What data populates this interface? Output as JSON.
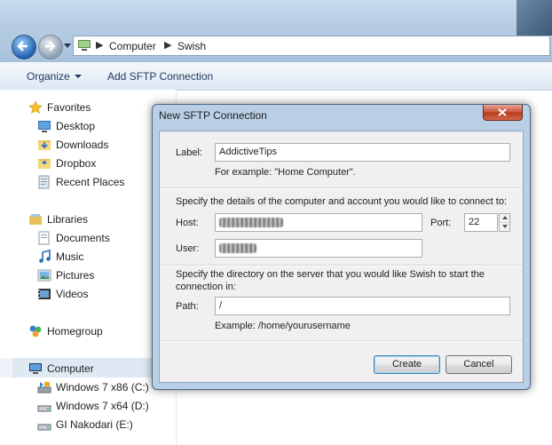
{
  "address": {
    "crumbs": [
      "Computer",
      "Swish"
    ],
    "separator": "▶"
  },
  "toolbar": {
    "organize": "Organize",
    "add_sftp": "Add SFTP Connection"
  },
  "sidebar": {
    "favorites": {
      "label": "Favorites",
      "items": [
        "Desktop",
        "Downloads",
        "Dropbox",
        "Recent Places"
      ]
    },
    "libraries": {
      "label": "Libraries",
      "items": [
        "Documents",
        "Music",
        "Pictures",
        "Videos"
      ]
    },
    "homegroup": {
      "label": "Homegroup"
    },
    "computer": {
      "label": "Computer",
      "items": [
        "Windows 7 x86 (C:)",
        "Windows 7 x64 (D:)",
        "GI Nakodari (E:)"
      ]
    }
  },
  "dialog": {
    "title": "New SFTP Connection",
    "label_caption": "Label:",
    "label_value": "AddictiveTips",
    "label_example": "For example: \"Home Computer\".",
    "details_text": "Specify the details of the computer and account you would like to connect to:",
    "host_caption": "Host:",
    "port_caption": "Port:",
    "port_value": "22",
    "user_caption": "User:",
    "directory_text_1": "Specify the directory on the server that you would like Swish to start the",
    "directory_text_2": "connection in:",
    "path_caption": "Path:",
    "path_value": "/",
    "path_example": "Example: /home/yourusername",
    "create_button": "Create",
    "cancel_button": "Cancel"
  }
}
